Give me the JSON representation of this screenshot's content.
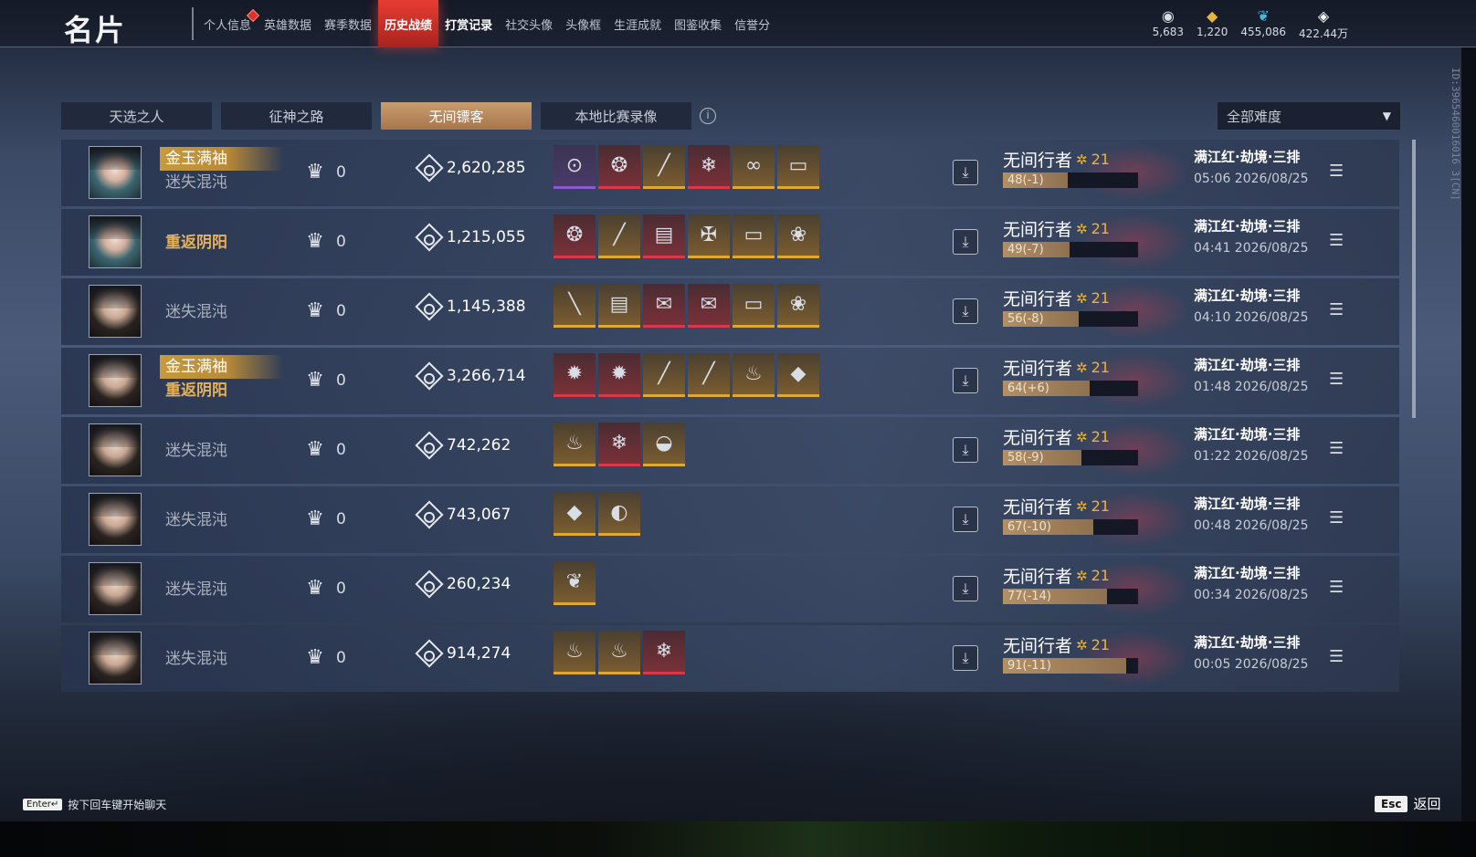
{
  "header": {
    "title": "名片",
    "tabs": [
      {
        "label": "个人信息",
        "state": "badge"
      },
      {
        "label": "英雄数据",
        "state": ""
      },
      {
        "label": "赛季数据",
        "state": ""
      },
      {
        "label": "历史战绩",
        "state": "active"
      },
      {
        "label": "打赏记录",
        "state": "bold"
      },
      {
        "label": "社交头像",
        "state": ""
      },
      {
        "label": "头像框",
        "state": ""
      },
      {
        "label": "生涯成就",
        "state": ""
      },
      {
        "label": "图鉴收集",
        "state": ""
      },
      {
        "label": "信誉分",
        "state": ""
      }
    ],
    "currencies": [
      {
        "icon": "mask-coin-icon",
        "glyph": "◉",
        "value": "5,683",
        "color": "#d9dde6"
      },
      {
        "icon": "gold-ingot-icon",
        "glyph": "◆",
        "value": "1,220",
        "color": "#e8b440"
      },
      {
        "icon": "feather-icon",
        "glyph": "❦",
        "value": "455,086",
        "color": "#4ab8e0"
      },
      {
        "icon": "jade-diamond-icon",
        "glyph": "◈",
        "value": "422.44万",
        "color": "#ffffff"
      }
    ],
    "uid": "ID:3965460016016 3[CN]"
  },
  "mode_tabs": [
    {
      "label": "天选之人",
      "active": false
    },
    {
      "label": "征神之路",
      "active": false
    },
    {
      "label": "无间镖客",
      "active": true
    },
    {
      "label": "本地比赛录像",
      "active": false
    }
  ],
  "difficulty_filter": {
    "value": "全部难度"
  },
  "records": [
    {
      "avatar": "teal",
      "titles": [
        {
          "text": "金玉满袖",
          "style": "gold"
        },
        {
          "text": "迷失混沌",
          "style": "grey"
        }
      ],
      "mvp": "0",
      "score": "2,620,285",
      "items": [
        {
          "glyph": "⊙",
          "q": "purple",
          "name": "jade-ring-icon"
        },
        {
          "glyph": "❂",
          "q": "red",
          "name": "wreath-icon"
        },
        {
          "glyph": "╱",
          "q": "gold",
          "name": "blade-icon"
        },
        {
          "glyph": "❄",
          "q": "red",
          "name": "crystal-icon"
        },
        {
          "glyph": "∞",
          "q": "gold",
          "name": "bracelet-icon"
        },
        {
          "glyph": "▭",
          "q": "gold",
          "name": "scroll-case-icon"
        }
      ],
      "rank_name": "无间行者",
      "rank_level": "21",
      "rank_bar_text": "48(-1)",
      "rank_fill": 0.48,
      "mode": "满江红·劫境·三排",
      "time": "05:06 2026/08/25"
    },
    {
      "avatar": "teal",
      "titles": [
        {
          "text": "重返阴阳",
          "style": "orange"
        }
      ],
      "mvp": "0",
      "score": "1,215,055",
      "items": [
        {
          "glyph": "❂",
          "q": "red",
          "name": "wreath-icon"
        },
        {
          "glyph": "╱",
          "q": "gold",
          "name": "blade-icon"
        },
        {
          "glyph": "▤",
          "q": "red",
          "name": "book-icon"
        },
        {
          "glyph": "✠",
          "q": "gold",
          "name": "cross-ornament-icon"
        },
        {
          "glyph": "▭",
          "q": "gold",
          "name": "scroll-case-icon"
        },
        {
          "glyph": "❀",
          "q": "gold",
          "name": "berries-icon"
        }
      ],
      "rank_name": "无间行者",
      "rank_level": "21",
      "rank_bar_text": "49(-7)",
      "rank_fill": 0.49,
      "mode": "满江红·劫境·三排",
      "time": "04:41 2026/08/25"
    },
    {
      "avatar": "dark",
      "titles": [
        {
          "text": "迷失混沌",
          "style": "grey"
        }
      ],
      "mvp": "0",
      "score": "1,145,388",
      "items": [
        {
          "glyph": "╲",
          "q": "gold",
          "name": "staff-icon"
        },
        {
          "glyph": "▤",
          "q": "gold",
          "name": "book-icon"
        },
        {
          "glyph": "✉",
          "q": "red",
          "name": "letter-icon"
        },
        {
          "glyph": "✉",
          "q": "red",
          "name": "letter-icon"
        },
        {
          "glyph": "▭",
          "q": "gold",
          "name": "scroll-case-icon"
        },
        {
          "glyph": "❀",
          "q": "gold",
          "name": "berries-icon"
        }
      ],
      "rank_name": "无间行者",
      "rank_level": "21",
      "rank_bar_text": "56(-8)",
      "rank_fill": 0.56,
      "mode": "满江红·劫境·三排",
      "time": "04:10 2026/08/25"
    },
    {
      "avatar": "dark",
      "titles": [
        {
          "text": "金玉满袖",
          "style": "gold"
        },
        {
          "text": "重返阴阳",
          "style": "orange"
        }
      ],
      "mvp": "0",
      "score": "3,266,714",
      "items": [
        {
          "glyph": "✹",
          "q": "red",
          "name": "flame-orb-icon"
        },
        {
          "glyph": "✹",
          "q": "red",
          "name": "flame-orb-icon"
        },
        {
          "glyph": "╱",
          "q": "gold",
          "name": "flute-icon"
        },
        {
          "glyph": "╱",
          "q": "gold",
          "name": "flute-icon"
        },
        {
          "glyph": "♨",
          "q": "gold",
          "name": "incense-icon"
        },
        {
          "glyph": "◆",
          "q": "gold",
          "name": "meat-icon"
        }
      ],
      "rank_name": "无间行者",
      "rank_level": "21",
      "rank_bar_text": "64(+6)",
      "rank_fill": 0.64,
      "mode": "满江红·劫境·三排",
      "time": "01:48 2026/08/25"
    },
    {
      "avatar": "dark",
      "titles": [
        {
          "text": "迷失混沌",
          "style": "grey"
        }
      ],
      "mvp": "0",
      "score": "742,262",
      "items": [
        {
          "glyph": "♨",
          "q": "gold",
          "name": "incense-icon"
        },
        {
          "glyph": "❄",
          "q": "red",
          "name": "crystal-icon"
        },
        {
          "glyph": "◒",
          "q": "gold",
          "name": "bowl-icon"
        }
      ],
      "rank_name": "无间行者",
      "rank_level": "21",
      "rank_bar_text": "58(-9)",
      "rank_fill": 0.58,
      "mode": "满江红·劫境·三排",
      "time": "01:22 2026/08/25"
    },
    {
      "avatar": "dark",
      "titles": [
        {
          "text": "迷失混沌",
          "style": "grey"
        }
      ],
      "mvp": "0",
      "score": "743,067",
      "items": [
        {
          "glyph": "◆",
          "q": "gold",
          "name": "meat-icon"
        },
        {
          "glyph": "◐",
          "q": "gold",
          "name": "moon-cake-icon"
        }
      ],
      "rank_name": "无间行者",
      "rank_level": "21",
      "rank_bar_text": "67(-10)",
      "rank_fill": 0.67,
      "mode": "满江红·劫境·三排",
      "time": "00:48 2026/08/25"
    },
    {
      "avatar": "dark",
      "titles": [
        {
          "text": "迷失混沌",
          "style": "grey"
        }
      ],
      "mvp": "0",
      "score": "260,234",
      "items": [
        {
          "glyph": "❦",
          "q": "gold",
          "name": "feather-icon"
        }
      ],
      "rank_name": "无间行者",
      "rank_level": "21",
      "rank_bar_text": "77(-14)",
      "rank_fill": 0.77,
      "mode": "满江红·劫境·三排",
      "time": "00:34 2026/08/25"
    },
    {
      "avatar": "dark",
      "titles": [
        {
          "text": "迷失混沌",
          "style": "grey"
        }
      ],
      "mvp": "0",
      "score": "914,274",
      "items": [
        {
          "glyph": "♨",
          "q": "gold",
          "name": "incense-icon"
        },
        {
          "glyph": "♨",
          "q": "gold",
          "name": "incense-icon"
        },
        {
          "glyph": "❄",
          "q": "red",
          "name": "crystal-icon"
        }
      ],
      "rank_name": "无间行者",
      "rank_level": "21",
      "rank_bar_text": "91(-11)",
      "rank_fill": 0.91,
      "mode": "满江红·劫境·三排",
      "time": "00:05 2026/08/25"
    }
  ],
  "footer": {
    "enter_key": "Enter↵",
    "enter_hint": "按下回车键开始聊天",
    "esc_key": "Esc",
    "esc_label": "返回"
  }
}
